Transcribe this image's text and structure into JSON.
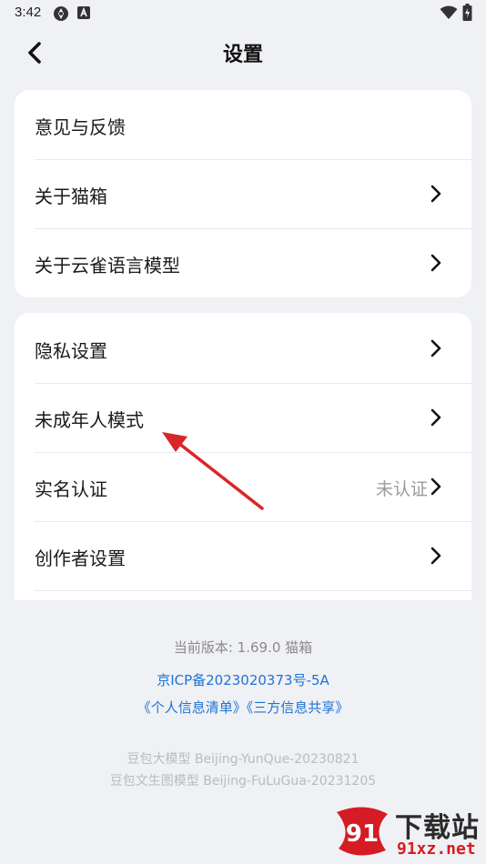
{
  "status_bar": {
    "time": "3:42"
  },
  "header": {
    "title": "设置"
  },
  "group1": [
    {
      "label": "意见与反馈",
      "chevron": false
    },
    {
      "label": "关于猫箱",
      "chevron": true
    },
    {
      "label": "关于云雀语言模型",
      "chevron": true
    }
  ],
  "group2": [
    {
      "label": "隐私设置",
      "value": ""
    },
    {
      "label": "未成年人模式",
      "value": ""
    },
    {
      "label": "实名认证",
      "value": "未认证"
    },
    {
      "label": "创作者设置",
      "value": ""
    }
  ],
  "footer": {
    "version": "当前版本: 1.69.0 猫箱",
    "icp": "京ICP备2023020373号-5A",
    "link_personal": "《个人信息清单》",
    "link_third_party": "《三方信息共享》",
    "model1": "豆包大模型 Beijing-YunQue-20230821",
    "model2": "豆包文生图模型 Beijing-FuLuGua-20231205"
  },
  "watermark": {
    "logo_text": "91",
    "title": "下载站",
    "url": "91xz.net"
  },
  "colors": {
    "background": "#f0f1f4",
    "card": "#ffffff",
    "link": "#1d73d6",
    "annotation": "#d9262a"
  }
}
